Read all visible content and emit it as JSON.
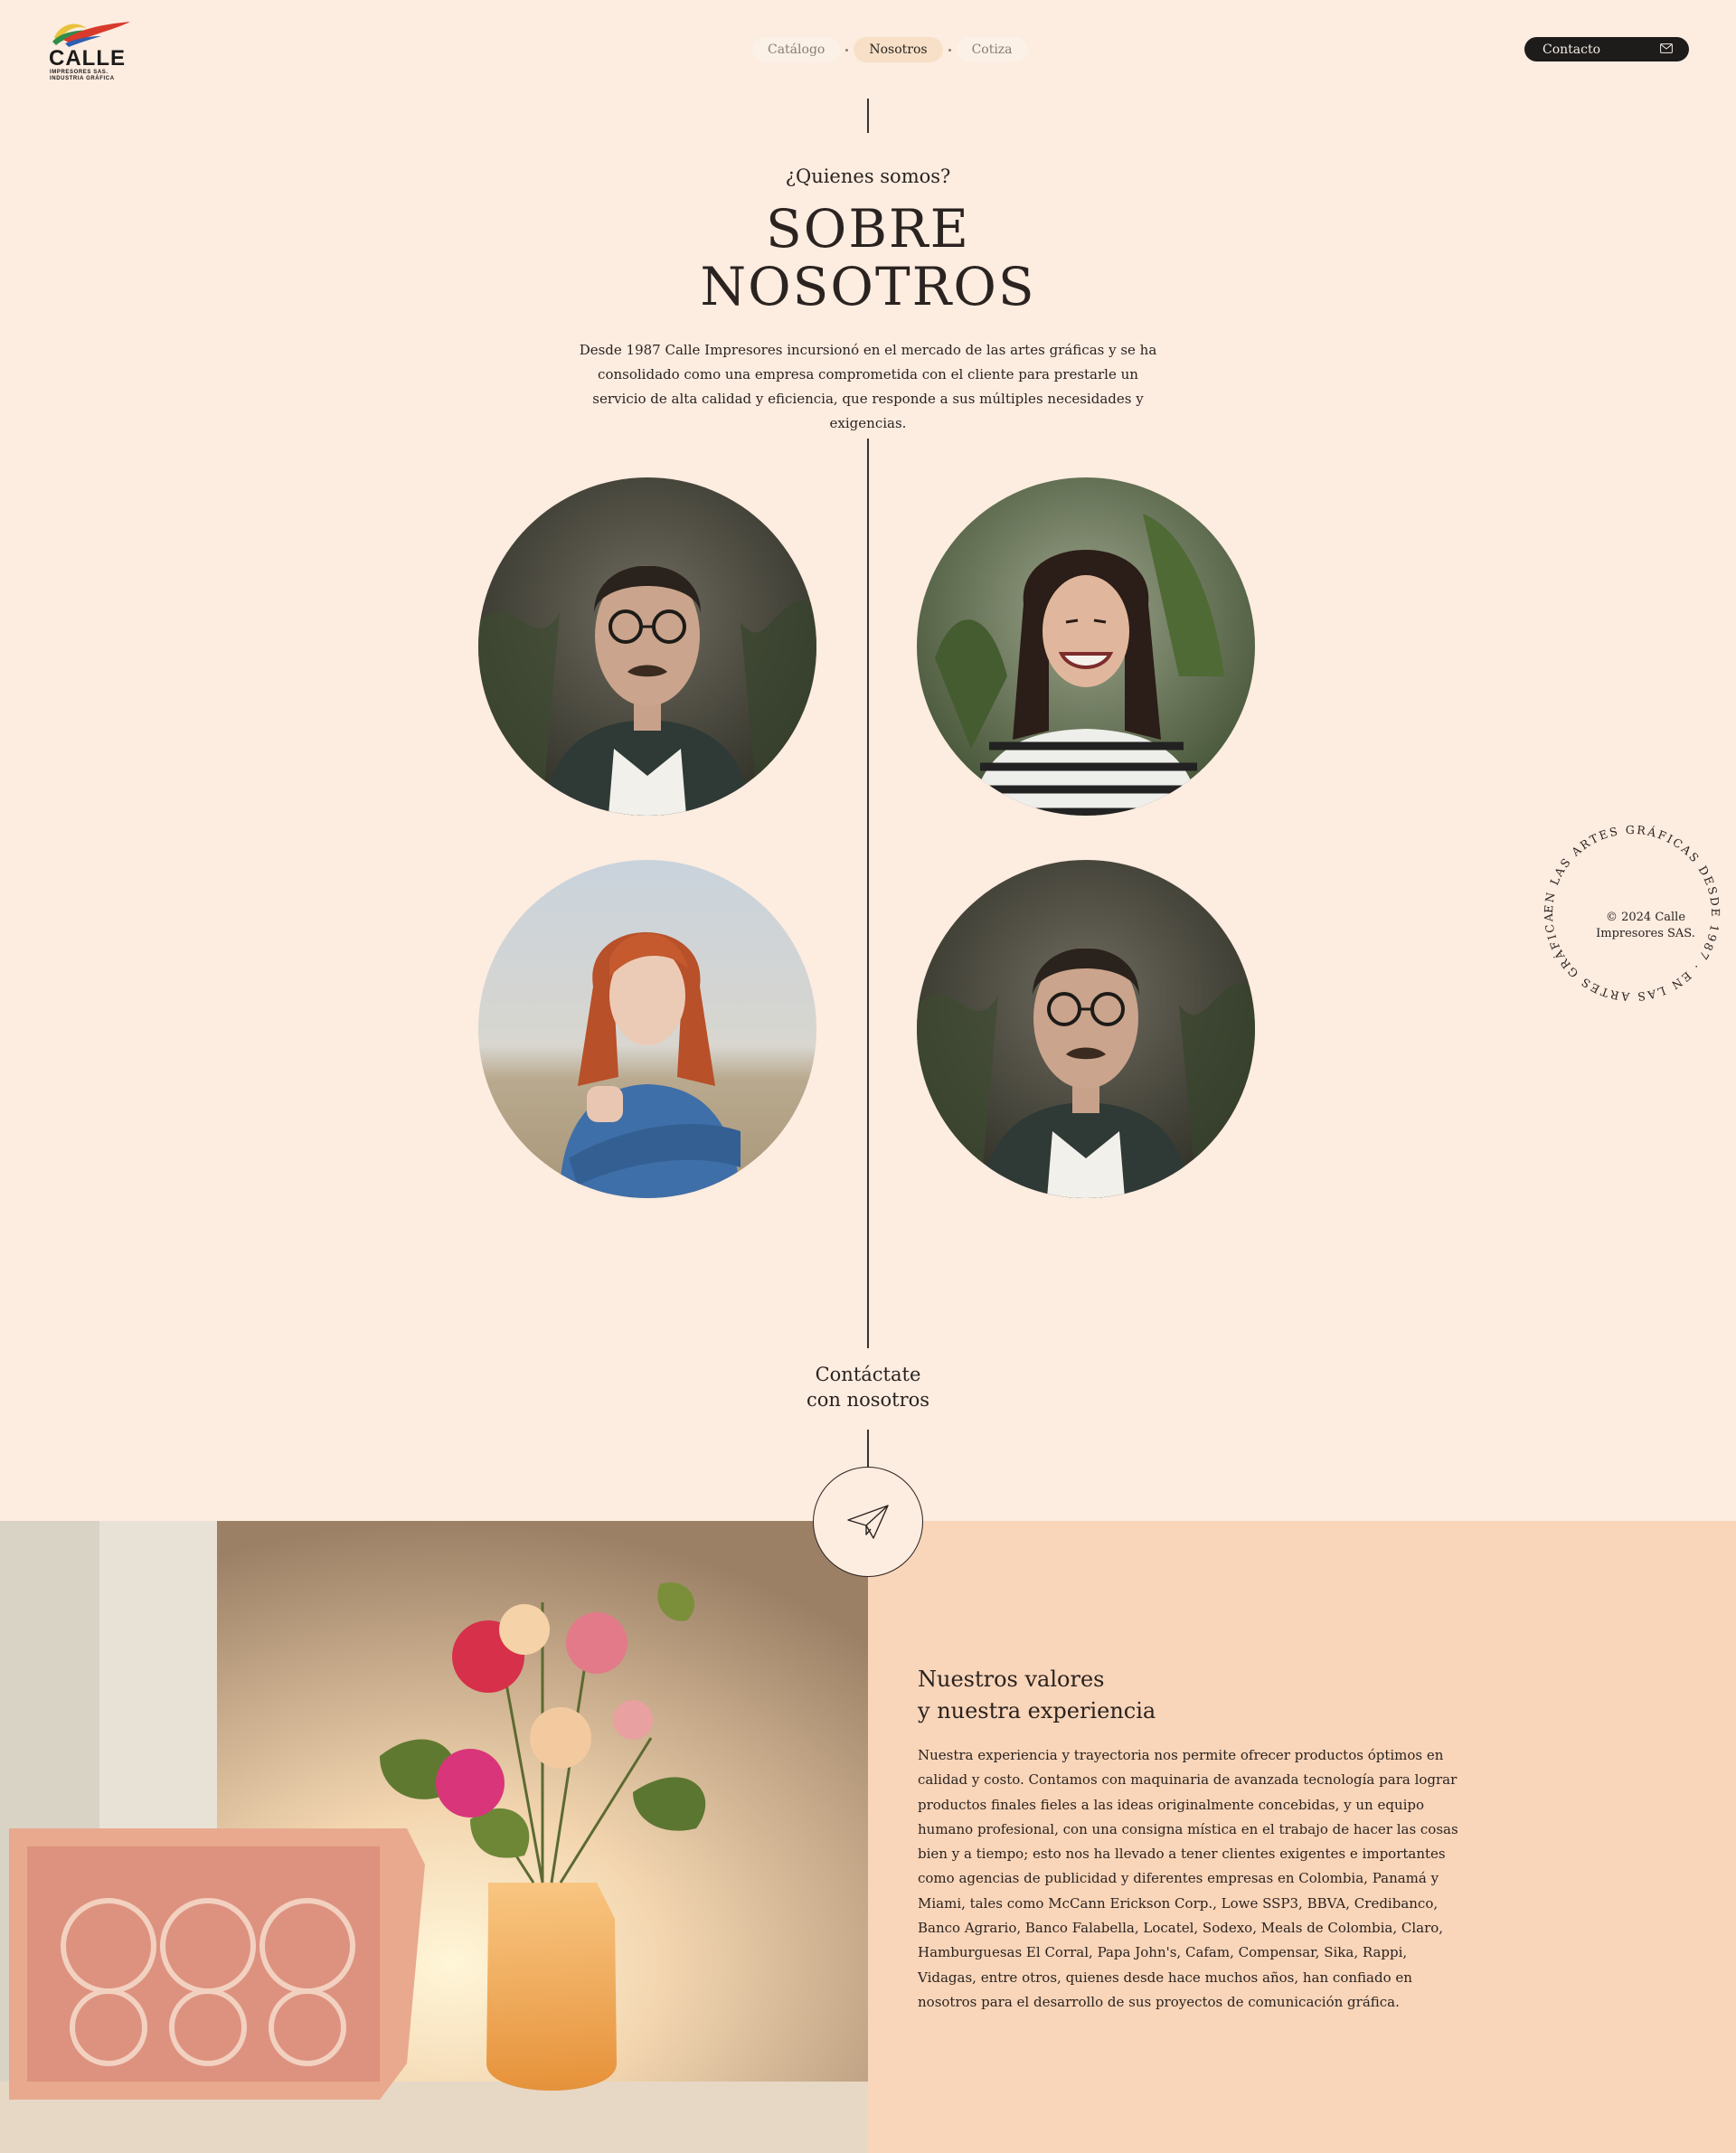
{
  "header": {
    "logo": {
      "name": "CALLE",
      "line1": "IMPRESORES SAS.",
      "line2": "INDUSTRIA GRÁFICA"
    },
    "nav": [
      {
        "label": "Catálogo",
        "active": false
      },
      {
        "label": "Nosotros",
        "active": true
      },
      {
        "label": "Cotiza",
        "active": false
      }
    ],
    "contact_label": "Contacto",
    "contact_icon": "mail-icon"
  },
  "about": {
    "eyebrow": "¿Quienes somos?",
    "title_line1": "SOBRE",
    "title_line2": "NOSOTROS",
    "description": "Desde 1987 Calle Impresores incursionó en el mercado de las artes gráficas y se ha consolidado como una empresa comprometida con el cliente para prestarle un servicio de alta calidad y eficiencia, que responde a sus múltiples necesidades y exigencias."
  },
  "team": [
    {
      "icon": "portrait-man-glasses"
    },
    {
      "icon": "portrait-woman-laughing"
    },
    {
      "icon": "portrait-woman-redhead"
    },
    {
      "icon": "portrait-man-glasses"
    }
  ],
  "badge": {
    "ring_text": "EN LAS ARTES GRÁFICAS DESDE 1987 · EN LAS ARTES GRÁFICAS DESDE 1987 · ",
    "copyright_line1": "© 2024 Calle",
    "copyright_line2": "Impresores SAS."
  },
  "cta": {
    "line1": "Contáctate",
    "line2": "con nosotros",
    "icon": "paper-plane-icon"
  },
  "values": {
    "title_line1": "Nuestros valores",
    "title_line2": "y nuestra experiencia",
    "body": "Nuestra experiencia y trayectoria nos permite ofrecer productos óptimos en calidad y costo. Contamos con maquinaria de avanzada tecnología para lograr productos finales fieles a las ideas originalmente concebidas, y un equipo humano profesional, con una consigna mística en el trabajo de hacer las cosas bien y a tiempo; esto nos ha llevado a tener clientes exigentes e importantes como agencias de publicidad y diferentes empresas en Colombia, Panamá y Miami, tales como McCann Erickson Corp., Lowe SSP3, BBVA, Credibanco, Banco Agrario, Banco Falabella, Locatel, Sodexo, Meals de Colombia, Claro, Hamburguesas El Corral, Papa John's, Cafam, Compensar, Sika, Rappi, Vidagas, entre otros, quienes desde hace muchos años, han confiado en nosotros para el desarrollo de sus proyectos de comunicación gráfica."
  },
  "colors": {
    "background": "#fdece0",
    "values_panel": "#f9d5b9",
    "text": "#2a2320",
    "button_dark": "#1e1c1b",
    "nav_active": "#f7e0c7"
  }
}
